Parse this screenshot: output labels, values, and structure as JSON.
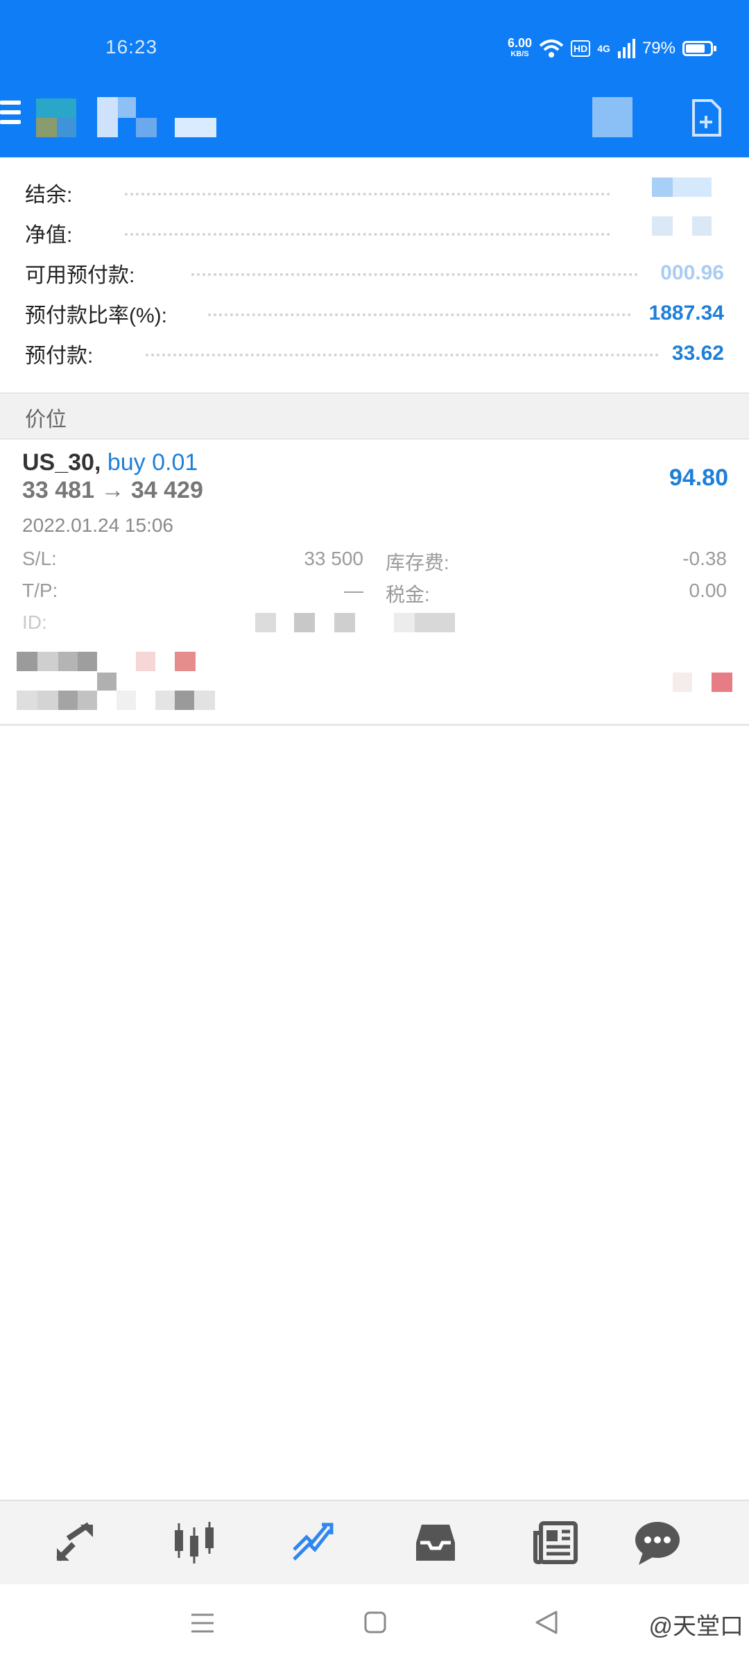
{
  "status_bar": {
    "time": "16:23",
    "net_speed": "6.00",
    "net_unit": "KB/S",
    "hd": "HD",
    "signal": "4G",
    "battery": "79%",
    "battery_level": 0.79
  },
  "account": {
    "rows": [
      {
        "label": "结余:",
        "value": ""
      },
      {
        "label": "净值:",
        "value": ""
      },
      {
        "label": "可用预付款:",
        "value": "000.96"
      },
      {
        "label": "预付款比率(%):",
        "value": "1887.34"
      },
      {
        "label": "预付款:",
        "value": "33.62"
      }
    ]
  },
  "section": {
    "title": "价位"
  },
  "position": {
    "symbol": "US_30,",
    "type": "buy 0.01",
    "price_line": "33 481 → 34 429",
    "profit": "94.80",
    "date": "2022.01.24 15:06",
    "sl_label": "S/L:",
    "sl_value": "33 500",
    "tp_label": "T/P:",
    "tp_value": "—",
    "swap_label": "库存费:",
    "swap_value": "-0.38",
    "tax_label": "税金:",
    "tax_value": "0.00",
    "id_label": "ID:"
  },
  "nav": {
    "items": [
      "quotes-icon",
      "chart-icon",
      "trade-icon",
      "history-icon",
      "news-icon",
      "chat-icon"
    ],
    "active_color": "#2f86f0"
  },
  "watermark": "@天堂口",
  "colors": {
    "brand": "#0e7df6",
    "value_blue": "#1e7fd8"
  }
}
